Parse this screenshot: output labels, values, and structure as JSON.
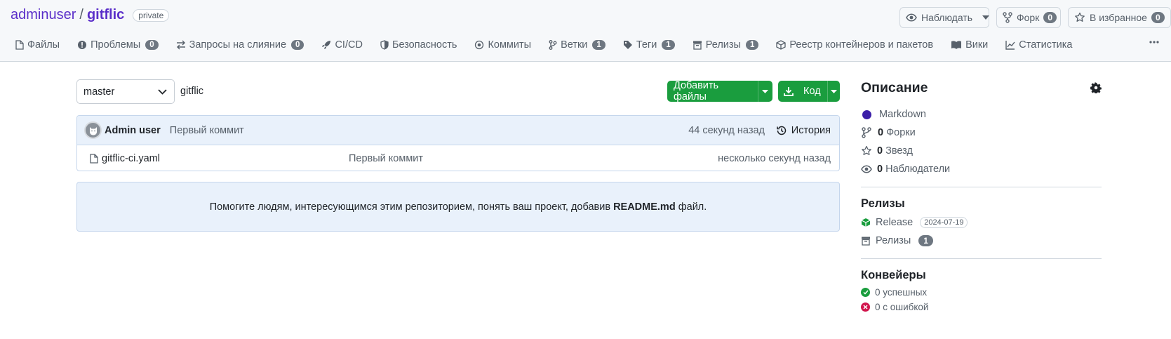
{
  "repo": {
    "owner": "adminuser",
    "separator": "/",
    "name": "gitflic",
    "visibility": "private"
  },
  "header_actions": {
    "watch_label": "Наблюдать",
    "fork_label": "Форк",
    "fork_count": "0",
    "star_label": "В избранное",
    "star_count": "0"
  },
  "tabs": [
    {
      "label": "Файлы",
      "icon": "file-icon"
    },
    {
      "label": "Проблемы",
      "icon": "issue-icon",
      "count": "0"
    },
    {
      "label": "Запросы на слияние",
      "icon": "merge-request-icon",
      "count": "0"
    },
    {
      "label": "CI/CD",
      "icon": "rocket-icon"
    },
    {
      "label": "Безопасность",
      "icon": "shield-icon"
    },
    {
      "label": "Коммиты",
      "icon": "commit-icon"
    },
    {
      "label": "Ветки",
      "icon": "branch-icon",
      "count": "1"
    },
    {
      "label": "Теги",
      "icon": "tag-icon",
      "count": "1"
    },
    {
      "label": "Релизы",
      "icon": "archive-icon",
      "count": "1"
    },
    {
      "label": "Реестр контейнеров и пакетов",
      "icon": "package-icon"
    },
    {
      "label": "Вики",
      "icon": "book-icon"
    },
    {
      "label": "Статистика",
      "icon": "graph-icon"
    }
  ],
  "toolbar": {
    "branch": "master",
    "path": "gitflic",
    "add_files_label": "Добавить файлы",
    "code_label": "Код"
  },
  "last_commit": {
    "author": "Admin user",
    "message": "Первый коммит",
    "time": "44 секунд назад",
    "history_label": "История"
  },
  "files": [
    {
      "name": "gitflic-ci.yaml",
      "message": "Первый коммит",
      "time": "несколько секунд назад"
    }
  ],
  "readme_notice": {
    "text_before": "Помогите людям, интересующимся этим репозиторием, понять ваш проект, добавив ",
    "file": "README.md",
    "text_after": " файл."
  },
  "sidebar": {
    "description_title": "Описание",
    "language": "Markdown",
    "language_color": "#3b1ea8",
    "forks_count": "0",
    "forks_label": "Форки",
    "stars_count": "0",
    "stars_label": "Звезд",
    "watchers_count": "0",
    "watchers_label": "Наблюдатели",
    "releases_title": "Релизы",
    "release_name": "Release",
    "release_date": "2024-07-19",
    "releases_label": "Релизы",
    "releases_count": "1",
    "pipelines_title": "Конвейеры",
    "success_label": "0 успешных",
    "failed_label": "0 с ошибкой"
  },
  "colors": {
    "accent": "#5b2fc9",
    "primary_button": "#1a9d3e",
    "success": "#1a9d3e",
    "error": "#d1164d"
  }
}
